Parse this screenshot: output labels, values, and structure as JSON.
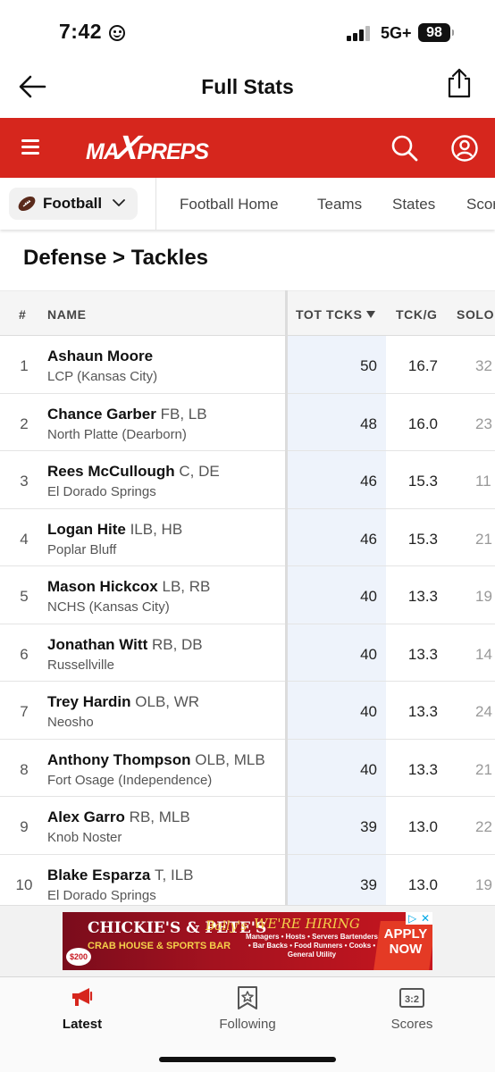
{
  "status_bar": {
    "time": "7:42",
    "network": "5G+",
    "battery": "98"
  },
  "nav": {
    "title": "Full Stats"
  },
  "brand": {
    "logo_text_left": "MA",
    "logo_text_x": "X",
    "logo_text_right": "PREPS",
    "accent_color": "#d6261d"
  },
  "sport_nav": {
    "selected_sport": "Football",
    "items": [
      "Football Home",
      "Teams",
      "States",
      "Scores"
    ]
  },
  "section": {
    "title": "Defense > Tackles"
  },
  "table": {
    "columns": {
      "rank": "#",
      "name": "NAME",
      "tot": "TOT TCKS",
      "tckg": "TCK/G",
      "solo": "SOLO"
    },
    "sorted_column": "TOT TCKS",
    "rows": [
      {
        "rank": "1",
        "name": "Ashaun Moore",
        "pos": "",
        "school": "LCP (Kansas City)",
        "tot": "50",
        "tckg": "16.7",
        "solo": "32"
      },
      {
        "rank": "2",
        "name": "Chance Garber",
        "pos": "FB, LB",
        "school": "North Platte (Dearborn)",
        "tot": "48",
        "tckg": "16.0",
        "solo": "23"
      },
      {
        "rank": "3",
        "name": "Rees McCullough",
        "pos": "C, DE",
        "school": "El Dorado Springs",
        "tot": "46",
        "tckg": "15.3",
        "solo": "11"
      },
      {
        "rank": "4",
        "name": "Logan Hite",
        "pos": "ILB, HB",
        "school": "Poplar Bluff",
        "tot": "46",
        "tckg": "15.3",
        "solo": "21"
      },
      {
        "rank": "5",
        "name": "Mason Hickcox",
        "pos": "LB, RB",
        "school": "NCHS (Kansas City)",
        "tot": "40",
        "tckg": "13.3",
        "solo": "19"
      },
      {
        "rank": "6",
        "name": "Jonathan Witt",
        "pos": "RB, DB",
        "school": "Russellville",
        "tot": "40",
        "tckg": "13.3",
        "solo": "14"
      },
      {
        "rank": "7",
        "name": "Trey Hardin",
        "pos": "OLB, WR",
        "school": "Neosho",
        "tot": "40",
        "tckg": "13.3",
        "solo": "24"
      },
      {
        "rank": "8",
        "name": "Anthony Thompson",
        "pos": "OLB, MLB",
        "school": "Fort Osage (Independence)",
        "tot": "40",
        "tckg": "13.3",
        "solo": "21"
      },
      {
        "rank": "9",
        "name": "Alex Garro",
        "pos": "RB, MLB",
        "school": "Knob Noster",
        "tot": "39",
        "tckg": "13.0",
        "solo": "22"
      },
      {
        "rank": "10",
        "name": "Blake Esparza",
        "pos": "T, ILB",
        "school": "El Dorado Springs",
        "tot": "39",
        "tckg": "13.0",
        "solo": "19"
      }
    ]
  },
  "ad": {
    "brand": "CHICKIE'S & PETE'S",
    "brand2": "Bally's",
    "subtitle": "CRAB HOUSE & SPORTS BAR",
    "badge": "$200",
    "headline": "WE'RE HIRING",
    "jobs": "Managers • Hosts • Servers Bartenders • Bar Backs • Food Runners • Cooks • General Utility",
    "cta": "APPLY NOW"
  },
  "tab_bar": {
    "items": [
      {
        "label": "Latest",
        "icon": "megaphone-icon",
        "active": true
      },
      {
        "label": "Following",
        "icon": "star-bookmark-icon",
        "active": false
      },
      {
        "label": "Scores",
        "icon": "scoreboard-icon",
        "active": false
      }
    ]
  }
}
